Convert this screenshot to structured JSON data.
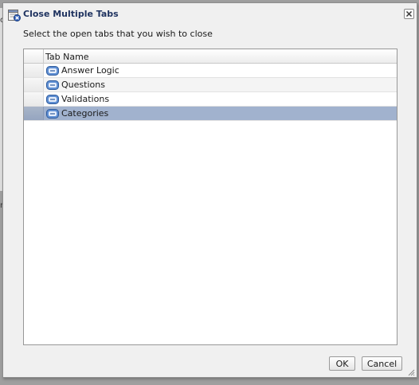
{
  "dialog": {
    "title": "Close Multiple Tabs",
    "instruction": "Select the open tabs that you wish to close",
    "table": {
      "column_header": "Tab Name",
      "rows": [
        {
          "label": "Answer Logic",
          "selected": false
        },
        {
          "label": "Questions",
          "selected": false
        },
        {
          "label": "Validations",
          "selected": false
        },
        {
          "label": "Categories",
          "selected": true
        }
      ]
    },
    "buttons": {
      "ok_label": "OK",
      "cancel_label": "Cancel"
    }
  },
  "background_fragments": [
    "c",
    "n"
  ],
  "icons": {
    "title": "close-tabs-icon",
    "close": "close-icon",
    "tab": "tab-icon",
    "resize": "resize-grip-icon"
  },
  "colors": {
    "title_text": "#1f3360",
    "selected_row": "#a1b2ce",
    "dialog_bg": "#f0f0f0"
  }
}
